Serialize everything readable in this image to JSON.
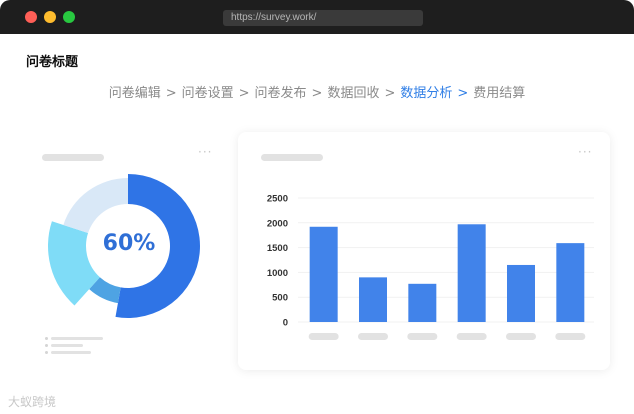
{
  "window": {
    "url": "https://survey.work/"
  },
  "page": {
    "title": "问卷标题"
  },
  "steps": [
    {
      "label": "问卷编辑",
      "active": false
    },
    {
      "label": "问卷设置",
      "active": false
    },
    {
      "label": "问卷发布",
      "active": false
    },
    {
      "label": "数据回收",
      "active": false
    },
    {
      "label": "数据分析",
      "active": true
    },
    {
      "label": "费用结算",
      "active": false
    }
  ],
  "step_separator": ">",
  "donut": {
    "center_label": "60%",
    "colors": [
      "#2f74e6",
      "#4ea3e3",
      "#7fdcf7",
      "#d9e8f7"
    ]
  },
  "more_icon": "···",
  "chart_data": {
    "type": "bar",
    "categories": [
      "",
      "",
      "",
      "",
      "",
      ""
    ],
    "values": [
      1920,
      900,
      770,
      1970,
      1150,
      1590
    ],
    "yticks": [
      "0",
      "500",
      "1000",
      "1500",
      "2000",
      "2500"
    ],
    "ylim": [
      0,
      2500
    ],
    "bar_color": "#4183ea",
    "grid": true
  },
  "watermark": "大蚁跨境"
}
